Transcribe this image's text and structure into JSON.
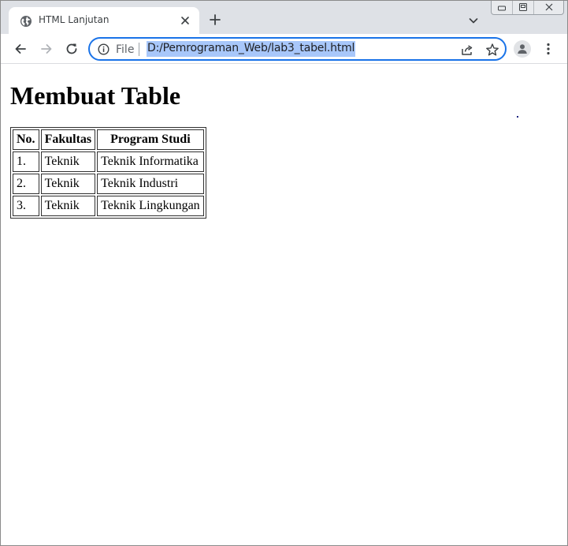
{
  "browser": {
    "tab": {
      "title": "HTML Lanjutan",
      "favicon": "globe-icon"
    },
    "address_bar": {
      "scheme_label": "File",
      "url": "D:/Pemrograman_Web/lab3_tabel.html"
    },
    "accent_color": "#1a73e8",
    "url_highlight_color": "#a8c7fa"
  },
  "page": {
    "heading": "Membuat Table",
    "table": {
      "headers": [
        "No.",
        "Fakultas",
        "Program Studi"
      ],
      "rows": [
        [
          "1.",
          "Teknik",
          "Teknik Informatika"
        ],
        [
          "2.",
          "Teknik",
          "Teknik Industri"
        ],
        [
          "3.",
          "Teknik",
          "Teknik Lingkungan"
        ]
      ]
    }
  }
}
